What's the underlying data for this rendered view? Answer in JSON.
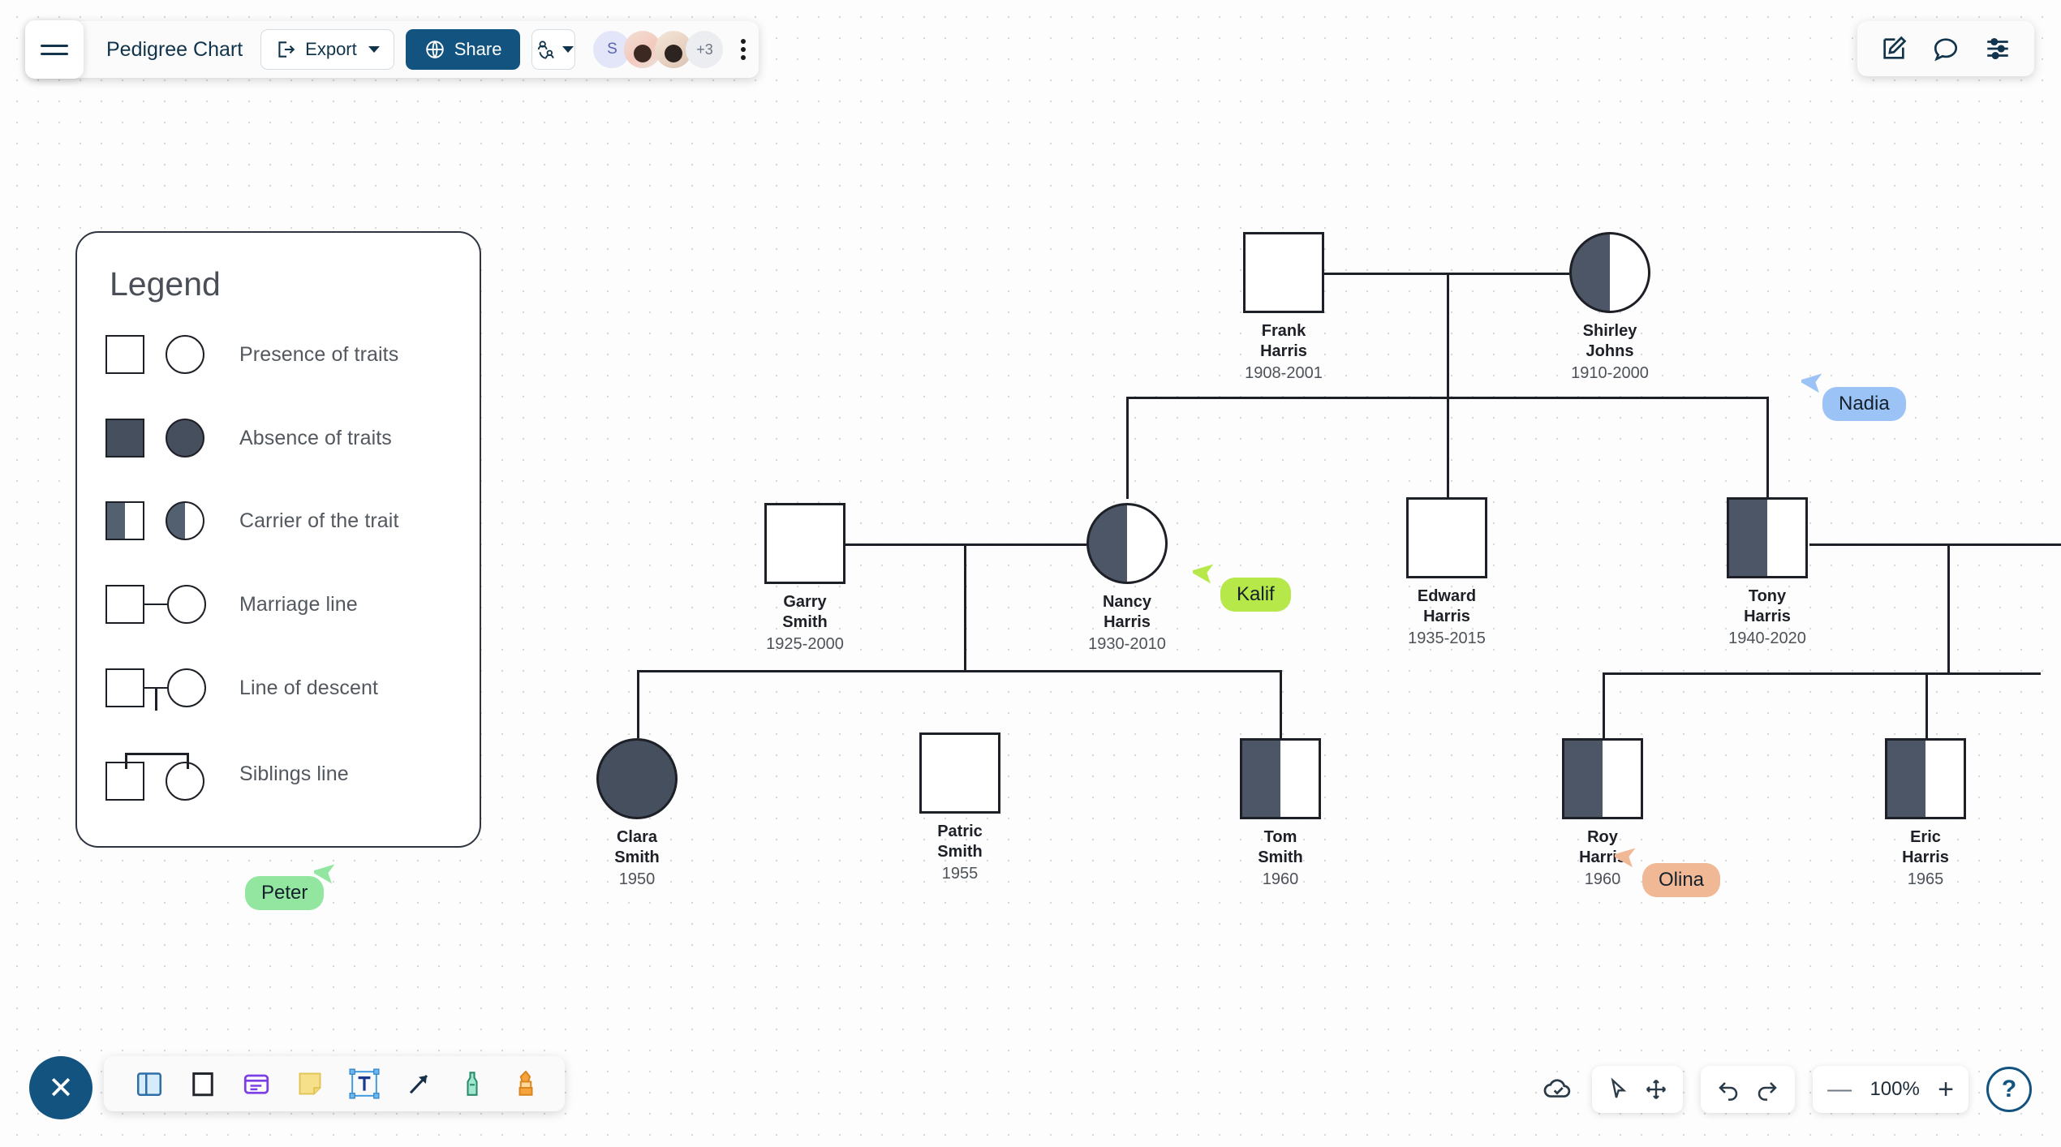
{
  "app": {
    "doc_title": "Pedigree Chart",
    "export_label": "Export",
    "share_label": "Share",
    "hamburger_name": "menu",
    "more_label": "more-options"
  },
  "collaborators": {
    "avatars": [
      {
        "type": "initial",
        "label": "S"
      },
      {
        "type": "photo",
        "label": ""
      },
      {
        "type": "photo",
        "label": ""
      },
      {
        "type": "overflow",
        "label": "+3"
      }
    ]
  },
  "top_right": {
    "edit_label": "edit",
    "comment_label": "comment",
    "settings_label": "settings"
  },
  "legend": {
    "title": "Legend",
    "rows": [
      {
        "text": "Presence of traits",
        "square": "open",
        "circle": "open"
      },
      {
        "text": "Absence of traits",
        "square": "filled",
        "circle": "filled"
      },
      {
        "text": "Carrier of the trait",
        "square": "half",
        "circle": "half"
      },
      {
        "text": "Marriage line",
        "square": "open",
        "circle": "open"
      },
      {
        "text": "Line of descent",
        "square": "open",
        "circle": "open"
      },
      {
        "text": "Siblings line",
        "square": "open",
        "circle": "open"
      }
    ]
  },
  "chart_data": {
    "type": "diagram",
    "title": "Pedigree Chart",
    "generations": 3,
    "people": [
      {
        "id": "frank",
        "name_line1": "Frank",
        "name_line2": "Harris",
        "years": "1908-2001",
        "sex": "male",
        "status": "open",
        "generation": 1
      },
      {
        "id": "shirley",
        "name_line1": "Shirley",
        "name_line2": "Johns",
        "years": "1910-2000",
        "sex": "female",
        "status": "half",
        "generation": 1
      },
      {
        "id": "garry",
        "name_line1": "Garry",
        "name_line2": "Smith",
        "years": "1925-2000",
        "sex": "male",
        "status": "open",
        "generation": 2
      },
      {
        "id": "nancy",
        "name_line1": "Nancy",
        "name_line2": "Harris",
        "years": "1930-2010",
        "sex": "female",
        "status": "half",
        "generation": 2
      },
      {
        "id": "edward",
        "name_line1": "Edward",
        "name_line2": "Harris",
        "years": "1935-2015",
        "sex": "male",
        "status": "open",
        "generation": 2
      },
      {
        "id": "tony",
        "name_line1": "Tony",
        "name_line2": "Harris",
        "years": "1940-2020",
        "sex": "male",
        "status": "half",
        "generation": 2
      },
      {
        "id": "clara",
        "name_line1": "Clara",
        "name_line2": "Smith",
        "years": "1950",
        "sex": "female",
        "status": "filled",
        "generation": 3
      },
      {
        "id": "patric",
        "name_line1": "Patric",
        "name_line2": "Smith",
        "years": "1955",
        "sex": "male",
        "status": "open",
        "generation": 3
      },
      {
        "id": "tom",
        "name_line1": "Tom",
        "name_line2": "Smith",
        "years": "1960",
        "sex": "male",
        "status": "half",
        "generation": 3
      },
      {
        "id": "roy",
        "name_line1": "Roy",
        "name_line2": "Harris",
        "years": "1960",
        "sex": "male",
        "status": "half",
        "generation": 3
      },
      {
        "id": "eric",
        "name_line1": "Eric",
        "name_line2": "Harris",
        "years": "1965",
        "sex": "male",
        "status": "half",
        "generation": 3
      }
    ],
    "marriages": [
      {
        "partners": [
          "frank",
          "shirley"
        ],
        "children": [
          "nancy",
          "edward",
          "tony"
        ]
      },
      {
        "partners": [
          "garry",
          "nancy"
        ],
        "children": [
          "clara",
          "tom"
        ]
      },
      {
        "partners": [
          "tony"
        ],
        "children": [
          "roy",
          "eric"
        ]
      }
    ],
    "symbol_key": {
      "open": "Presence of traits",
      "filled": "Absence of traits",
      "half": "Carrier of the trait"
    }
  },
  "cursors": [
    {
      "name": "Kalif",
      "color": "#b6e84a"
    },
    {
      "name": "Nadia",
      "color": "#9cc3f5"
    },
    {
      "name": "Peter",
      "color": "#92e6a0"
    },
    {
      "name": "Olina",
      "color": "#f0b894"
    }
  ],
  "tools": {
    "close_label": "✕",
    "items": [
      {
        "name": "table-tool",
        "label": "Table"
      },
      {
        "name": "shape-tool",
        "label": "Shape"
      },
      {
        "name": "card-tool",
        "label": "Card"
      },
      {
        "name": "sticky-note-tool",
        "label": "Sticky note"
      },
      {
        "name": "text-tool",
        "label": "Text",
        "selected": true
      },
      {
        "name": "arrow-tool",
        "label": "Arrow"
      },
      {
        "name": "pen-tool",
        "label": "Pen"
      },
      {
        "name": "highlighter-tool",
        "label": "Highlighter"
      }
    ]
  },
  "bottom_right": {
    "save_status": "saved",
    "select_label": "select",
    "pan_label": "pan",
    "undo_label": "undo",
    "redo_label": "redo",
    "zoom_out_label": "—",
    "zoom_level": "100%",
    "zoom_in_label": "+",
    "help_label": "?"
  }
}
